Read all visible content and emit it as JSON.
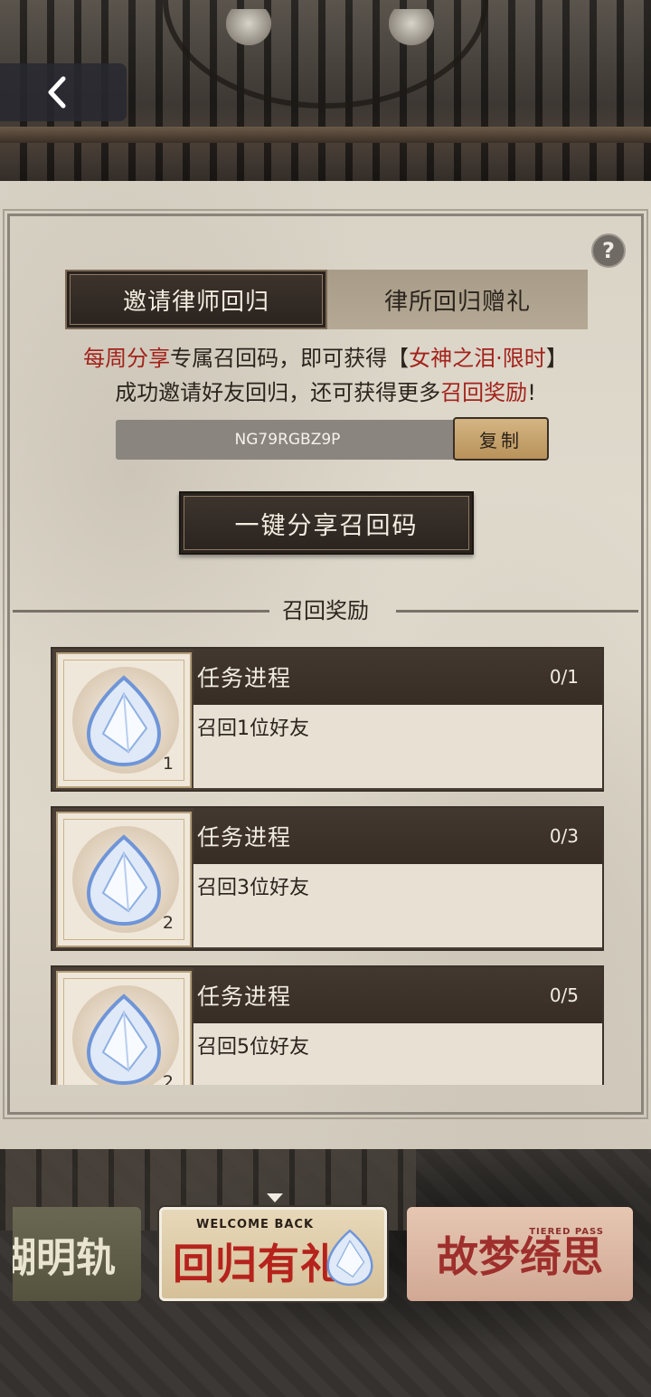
{
  "header": {
    "back_icon": "chevron-left-icon"
  },
  "help": {
    "label": "?"
  },
  "tabs": [
    {
      "label": "邀请律师回归",
      "active": true
    },
    {
      "label": "律所回归赠礼",
      "active": false
    }
  ],
  "description": {
    "line1_a": "每周分享",
    "line1_b": "专属召回码，即可获得【",
    "line1_c": "女神之泪·限时",
    "line1_d": "】",
    "line2_a": "成功邀请好友回归，还可获得更多",
    "line2_b": "召回奖励",
    "line2_c": "!"
  },
  "code": {
    "value": "NG79RGBZ9P",
    "copy_label": "复制"
  },
  "share_button": {
    "label": "一键分享召回码"
  },
  "rewards_section": {
    "title": "召回奖励",
    "items": [
      {
        "task_label": "任务进程",
        "progress": "0/1",
        "description": "召回1位好友",
        "count": "1"
      },
      {
        "task_label": "任务进程",
        "progress": "0/3",
        "description": "召回3位好友",
        "count": "2"
      },
      {
        "task_label": "任务进程",
        "progress": "0/5",
        "description": "召回5位好友",
        "count": "2"
      }
    ]
  },
  "banners": {
    "left": {
      "text": "糊明轨"
    },
    "middle": {
      "small": "WELCOME BACK",
      "big": "回归有礼"
    },
    "right": {
      "text": "故梦绮思",
      "small": "TIERED PASS"
    }
  },
  "colors": {
    "accent_red": "#a3221b",
    "dark_brown": "#2a231e",
    "paper": "#e3ddd0"
  }
}
